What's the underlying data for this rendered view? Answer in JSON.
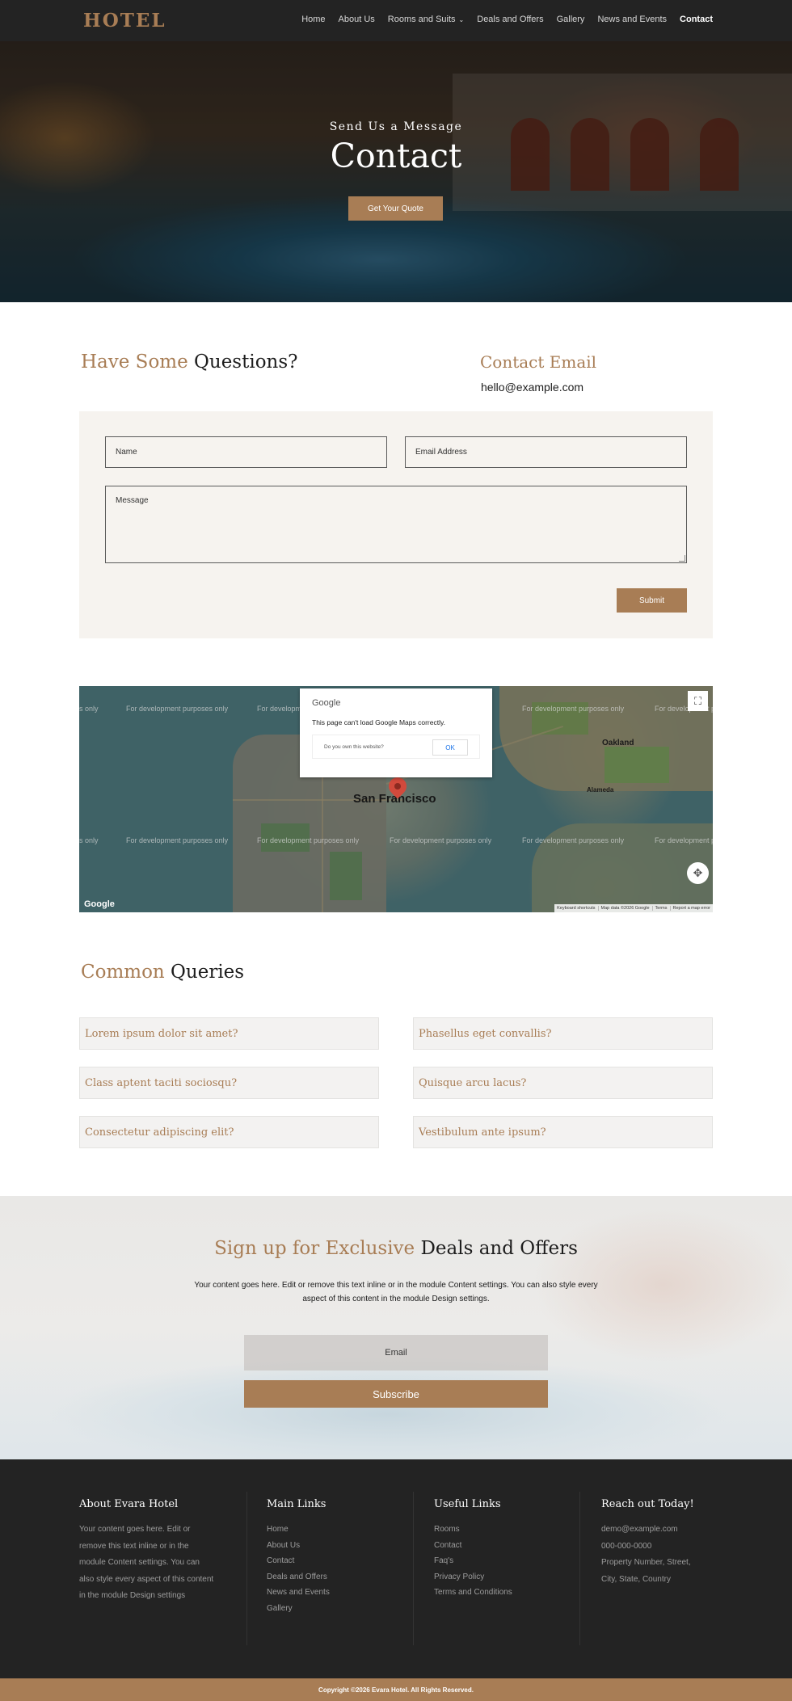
{
  "colors": {
    "accent": "#a87d55",
    "nav_bg": "#232323",
    "footer_bg": "#232323",
    "form_bg": "#f6f3ef"
  },
  "nav": {
    "logo": "HOTEL",
    "items": [
      {
        "label": "Home"
      },
      {
        "label": "About Us"
      },
      {
        "label": "Rooms and Suits"
      },
      {
        "label": "Deals and Offers"
      },
      {
        "label": "Gallery"
      },
      {
        "label": "News and Events"
      },
      {
        "label": "Contact"
      }
    ],
    "active": "Contact"
  },
  "hero": {
    "subtitle": "Send Us a Message",
    "title": "Contact",
    "button": "Get Your Quote"
  },
  "contact": {
    "heading_accent": "Have Some",
    "heading_rest": "Questions?",
    "email_title": "Contact Email",
    "email_value": "hello@example.com",
    "form": {
      "name_placeholder": "Name",
      "email_placeholder": "Email Address",
      "message_placeholder": "Message",
      "submit": "Submit"
    }
  },
  "map": {
    "watermark": "For development purposes only",
    "watermark_clip": "s only",
    "city": "San Francisco",
    "oakland": "Oakland",
    "alameda": "Alameda",
    "dialog": {
      "logo": "Google",
      "message": "This page can't load Google Maps correctly.",
      "question": "Do you own this website?",
      "ok": "OK"
    },
    "google": "Google",
    "attribution": [
      "Keyboard shortcuts",
      "Map data ©2026 Google",
      "Terms",
      "Report a map error"
    ],
    "fullscreen_icon": "fullscreen-icon",
    "nav_icon": "map-move-icon"
  },
  "queries": {
    "heading_accent": "Common",
    "heading_rest": "Queries",
    "items": [
      "Lorem ipsum dolor sit amet?",
      "Phasellus eget convallis?",
      "Class aptent taciti sociosqu?",
      "Quisque arcu lacus?",
      "Consectetur adipiscing elit?",
      "Vestibulum ante ipsum?"
    ]
  },
  "signup": {
    "heading_accent": "Sign up for Exclusive",
    "heading_rest": "Deals and Offers",
    "body": "Your content goes here. Edit or remove this text inline or in the module Content settings. You can also style every aspect of this content in the module Design settings.",
    "email_placeholder": "Email",
    "button": "Subscribe"
  },
  "footer": {
    "about_title": "About Evara Hotel",
    "about_text": "Your content goes here. Edit or remove this text inline or in the module Content settings. You can also style every aspect of this content in the module Design settings",
    "main_title": "Main Links",
    "main_links": [
      "Home",
      "About Us",
      "Contact",
      "Deals and Offers",
      "News and Events",
      "Gallery"
    ],
    "useful_title": "Useful Links",
    "useful_links": [
      "Rooms",
      "Contact",
      "Faq's",
      "Privacy Policy",
      "Terms and Conditions"
    ],
    "reach_title": "Reach out Today!",
    "reach_lines": [
      "demo@example.com",
      "000-000-0000",
      "Property Number, Street,",
      "City, State, Country"
    ],
    "copyright": "Copyright ©2026 Evara Hotel. All Rights Reserved."
  }
}
